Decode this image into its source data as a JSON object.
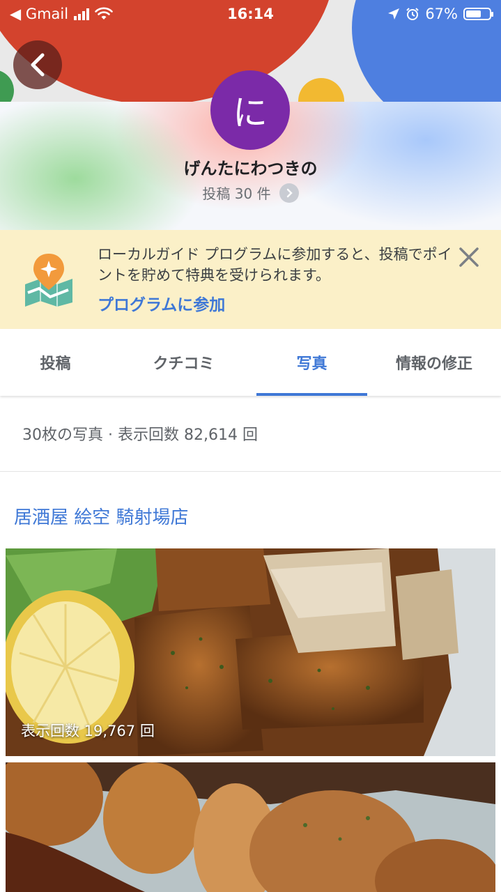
{
  "status_bar": {
    "back_app": "◀ Gmail",
    "time": "16:14",
    "battery": "67%",
    "battery_level": 0.67
  },
  "profile": {
    "avatar_letter": "に",
    "name": "げんたにわつきの",
    "post_count": "投稿 30 件"
  },
  "banner": {
    "text": "ローカルガイド プログラムに参加すると、投稿でポイントを貯めて特典を受けられます。",
    "link": "プログラムに参加"
  },
  "tabs": [
    {
      "label": "投稿",
      "active": false
    },
    {
      "label": "クチコミ",
      "active": false
    },
    {
      "label": "写真",
      "active": true
    },
    {
      "label": "情報の修正",
      "active": false
    }
  ],
  "summary": "30枚の写真 · 表示回数 82,614 回",
  "place": {
    "name": "居酒屋 絵空 騎射場店"
  },
  "photos": [
    {
      "views": "表示回数 19,767 回",
      "icon": "fried-food-photo"
    },
    {
      "views": "",
      "icon": "fried-food-photo"
    }
  ],
  "colors": {
    "accent": "#3f78d6",
    "avatar": "#7b2aa8",
    "banner_bg": "#fbf0c8"
  }
}
